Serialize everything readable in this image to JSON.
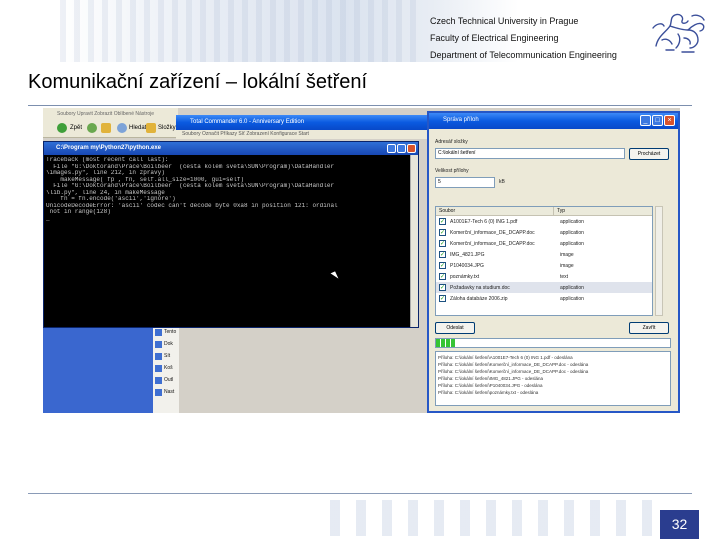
{
  "header": {
    "university": "Czech Technical University in Prague",
    "faculty": "Faculty of Electrical Engineering",
    "department": "Department of Telecommunication Engineering"
  },
  "slide": {
    "title": "Komunikační zařízení – lokální šetření",
    "page_number": "32"
  },
  "colors": {
    "accent": "#2a3d8f",
    "xp_titlebar": "#0a5ae0",
    "console_bg": "#000000",
    "progress": "#37c435"
  },
  "explorer": {
    "menu": "Soubory  Upravit  Zobrazit  Oblíbené  Nástroje",
    "back_label": "Zpět",
    "search_label": "Hledat",
    "folders_label": "Složky"
  },
  "total_commander": {
    "title": "Total Commander 6.0 - Anniversary Edition",
    "menu": "Soubory  Označit  Příkazy  Síť  Zobrazení  Konfigurace  Start"
  },
  "console": {
    "title": "C:\\Program my\\Python27\\python.exe",
    "lines": [
      "Traceback (most recent call last):",
      "  File \"G:\\Doktorand\\Práce\\Boilbeer  (cesta kolem sveta\\SUN\\Program)\\DataHandler",
      "\\images.py\", line 212, in zpravy)",
      "    makeMessage( fp , fn, self.all_size=1000, gui=self)",
      "  File \"G:\\Doktorand\\Práce\\Boilbeer  (cesta kolem sveta\\SUN\\Program)\\DataHandler",
      "\\lib.py\", line 24, in makeMessage",
      "    fn = fn.encode('ascii','ignore')",
      "UnicodeDecodeError: 'ascii' codec can't decode byte 0xa8 in position 121: ordinal",
      " not in range(128)",
      "_"
    ]
  },
  "desktop_icons": [
    "Tento",
    "Dok",
    "Sít",
    "Koš",
    "Outl",
    "Nast"
  ],
  "dialog": {
    "title": "Správa příloh",
    "folder_label": "Adresář složky",
    "folder_value": "C:\\lokální šetření",
    "browse_button": "Procházet",
    "size_label": "Velikost přílohy",
    "size_value": "5",
    "size_unit": "kB",
    "columns": {
      "name": "Soubor",
      "type": "Typ"
    },
    "files": [
      {
        "name": "A1001E7-Tech 6 (0) ING 1.pdf",
        "type": "application"
      },
      {
        "name": "Komerční_informace_DE_DCAPP.doc",
        "type": "application"
      },
      {
        "name": "Komerční_informace_DE_DCAPP.doc",
        "type": "application"
      },
      {
        "name": "IMG_4821.JPG",
        "type": "image"
      },
      {
        "name": "P1040034.JPG",
        "type": "image"
      },
      {
        "name": "poznámky.txt",
        "type": "text"
      },
      {
        "name": "Požadavky na studium.doc",
        "type": "application"
      },
      {
        "name": "Záloha databáze 2006.zip",
        "type": "application"
      }
    ],
    "selected_index": 6,
    "send_button": "Odeslat",
    "close_button": "Zavřít",
    "progress": 0.08,
    "log": [
      "Příloha: C:\\lokální šetření\\A1001E7-Tech 6 (0) ING 1.pdf  - odeslána",
      "Příloha: C:\\lokální šetření\\Komerční_informace_DE_DCAPP.doc  - odeslána",
      "Příloha: C:\\lokální šetření\\Komerční_informace_DE_DCAPP.doc  - odeslána",
      "Příloha: C:\\lokální šetření\\IMG_4821.JPG  - odeslána",
      "Příloha: C:\\lokální šetření\\P1040034.JPG  - odeslána",
      "Příloha: C:\\lokální šetření\\poznámky.txt  - odeslána"
    ]
  }
}
